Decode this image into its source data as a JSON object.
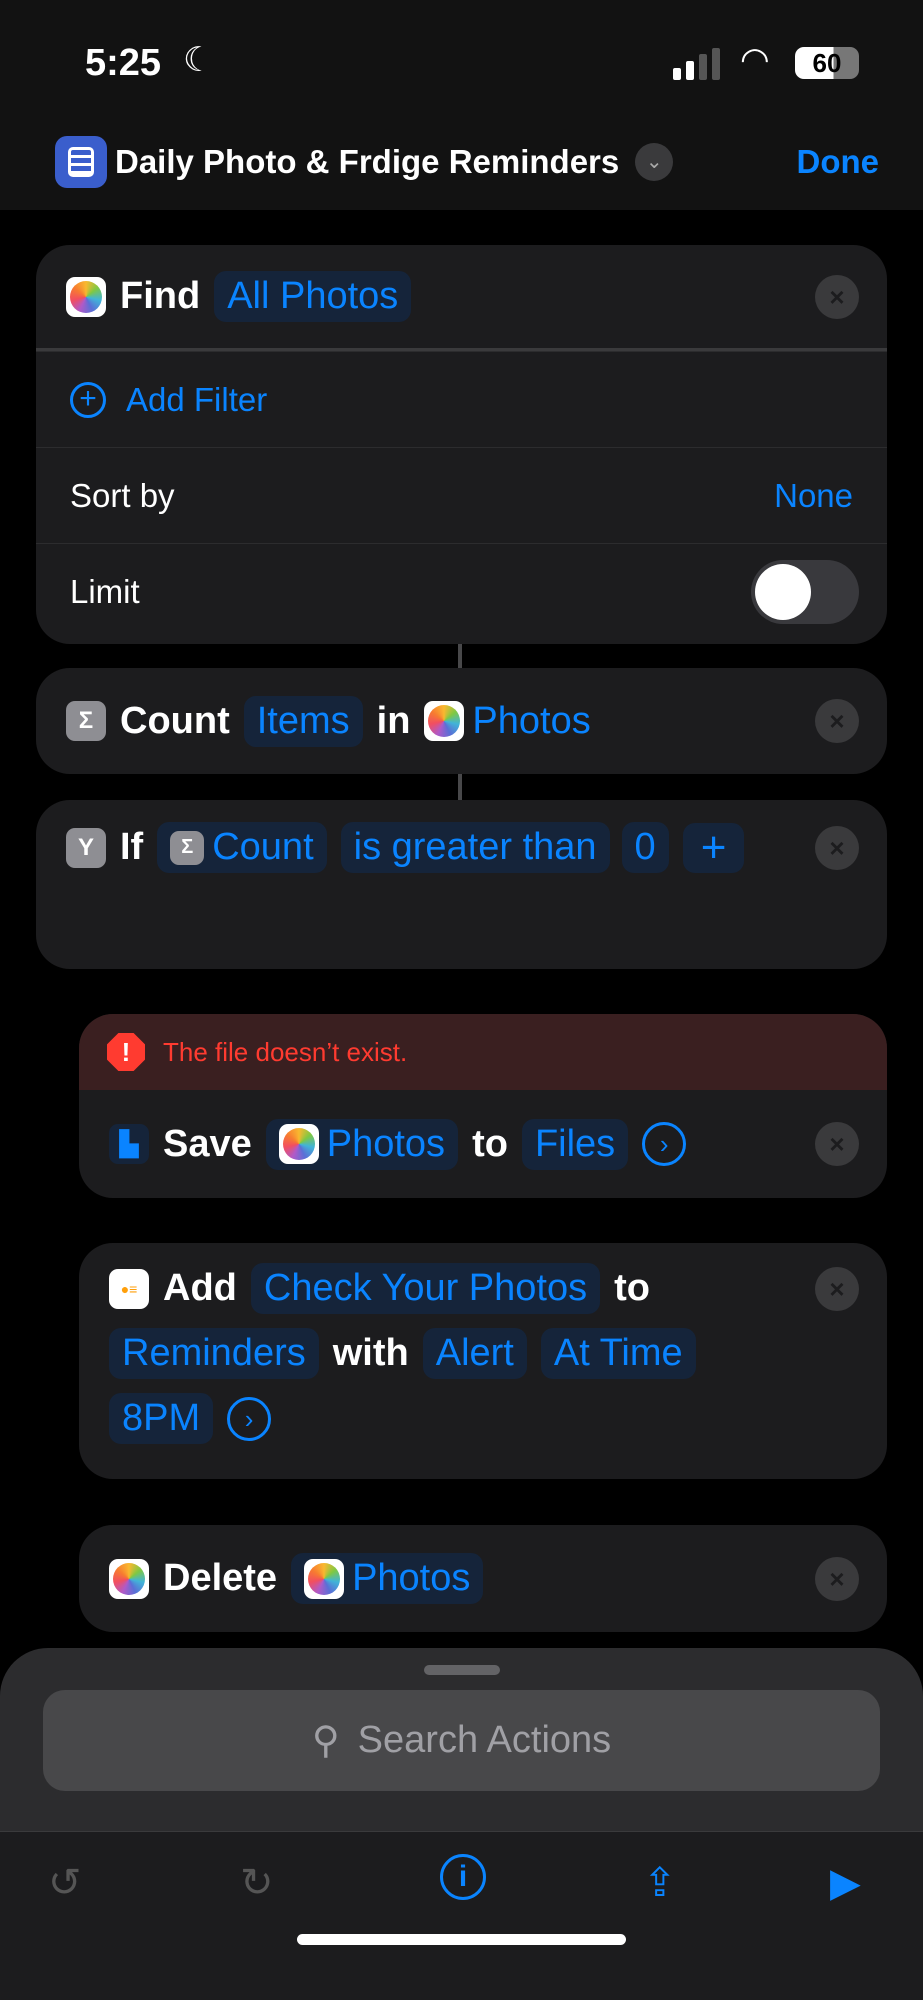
{
  "status": {
    "time": "5:25",
    "battery": "60"
  },
  "nav": {
    "title": "Daily Photo & Frdige Reminders",
    "done": "Done"
  },
  "find": {
    "verb": "Find",
    "target": "All Photos",
    "add_filter": "Add Filter",
    "sort_label": "Sort by",
    "sort_value": "None",
    "limit_label": "Limit",
    "limit_on": false
  },
  "count": {
    "verb": "Count",
    "what": "Items",
    "in": "in",
    "source": "Photos"
  },
  "if": {
    "verb": "If",
    "var": "Count",
    "cond": "is greater than",
    "value": "0",
    "add": "+"
  },
  "save": {
    "error": "The file doesn’t exist.",
    "verb": "Save",
    "what": "Photos",
    "to": "to",
    "dest": "Files"
  },
  "reminder": {
    "verb": "Add",
    "title": "Check Your Photos",
    "to": "to",
    "list": "Reminders",
    "with": "with",
    "alert": "Alert",
    "at": "At Time",
    "time": "8PM"
  },
  "delete": {
    "verb": "Delete",
    "what": "Photos"
  },
  "search": {
    "placeholder": "Search Actions"
  },
  "colors": {
    "accent": "#0a84ff",
    "error": "#ff3b30"
  }
}
